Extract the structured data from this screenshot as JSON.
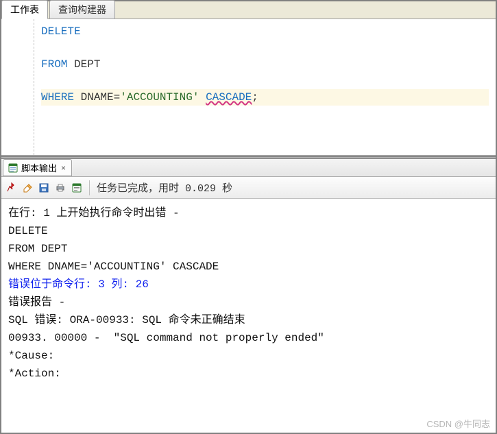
{
  "tabs": {
    "worksheet": "工作表",
    "query_builder": "查询构建器"
  },
  "sql": {
    "lines": [
      {
        "tokens": [
          {
            "t": "DELETE",
            "c": "kw"
          }
        ]
      },
      {
        "tokens": [
          {
            "t": "FROM",
            "c": "kw"
          },
          {
            "t": " DEPT",
            "c": "ident"
          }
        ]
      },
      {
        "tokens": [
          {
            "t": "WHERE",
            "c": "kw"
          },
          {
            "t": " DNAME=",
            "c": "ident"
          },
          {
            "t": "'ACCOUNTING'",
            "c": "str"
          },
          {
            "t": " ",
            "c": "ident"
          },
          {
            "t": "CASCADE",
            "c": "kw squiggle"
          },
          {
            "t": ";",
            "c": "ident"
          }
        ],
        "highlight": true
      }
    ]
  },
  "output_tab": {
    "label": "脚本输出",
    "close": "×"
  },
  "toolbar": {
    "status": "任务已完成，用时 0.029 秒"
  },
  "output": {
    "lines": [
      {
        "text": "在行: 1 上开始执行命令时出错 -"
      },
      {
        "text": "DELETE"
      },
      {
        "text": "FROM DEPT"
      },
      {
        "text": "WHERE DNAME='ACCOUNTING' CASCADE"
      },
      {
        "text": "错误位于命令行: 3 列: 26",
        "class": "errline"
      },
      {
        "text": "错误报告 -"
      },
      {
        "text": "SQL 错误: ORA-00933: SQL 命令未正确结束"
      },
      {
        "text": "00933. 00000 -  \"SQL command not properly ended\""
      },
      {
        "text": "*Cause:"
      },
      {
        "text": "*Action:"
      }
    ]
  },
  "watermark": "CSDN @牛同志"
}
